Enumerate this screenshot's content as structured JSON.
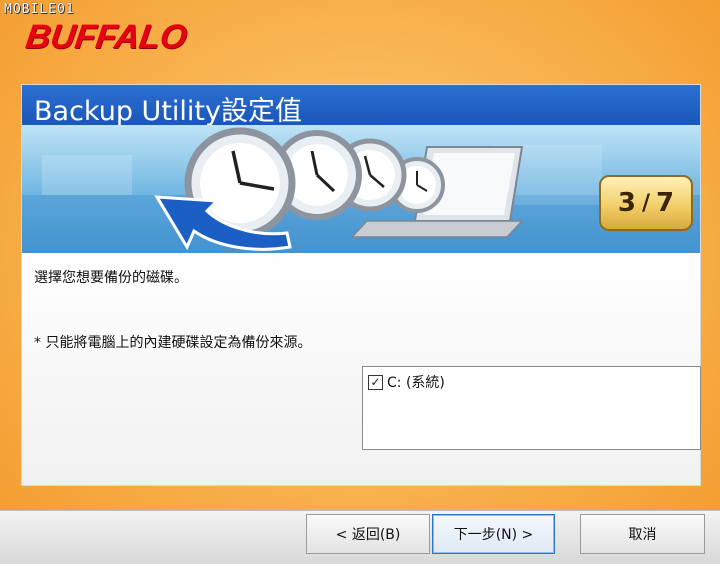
{
  "watermark": "MOBILE01",
  "brand": "BUFFALO",
  "wizard": {
    "title": "Backup Utility設定值",
    "step_current": "3",
    "step_separator": "/",
    "step_total": "7"
  },
  "content": {
    "instruction": "選擇您想要備份的磁碟。",
    "note": "* 只能將電腦上的內建硬碟設定為備份來源。",
    "drives": [
      {
        "label": "C: (系統)",
        "checked": true
      }
    ]
  },
  "buttons": {
    "back": "< 返回(B)",
    "next": "下一步(N) >",
    "cancel": "取消"
  },
  "colors": {
    "title_bar": "#1e5fc0",
    "brand_red": "#e60012",
    "background_orange": "#f9b654"
  }
}
